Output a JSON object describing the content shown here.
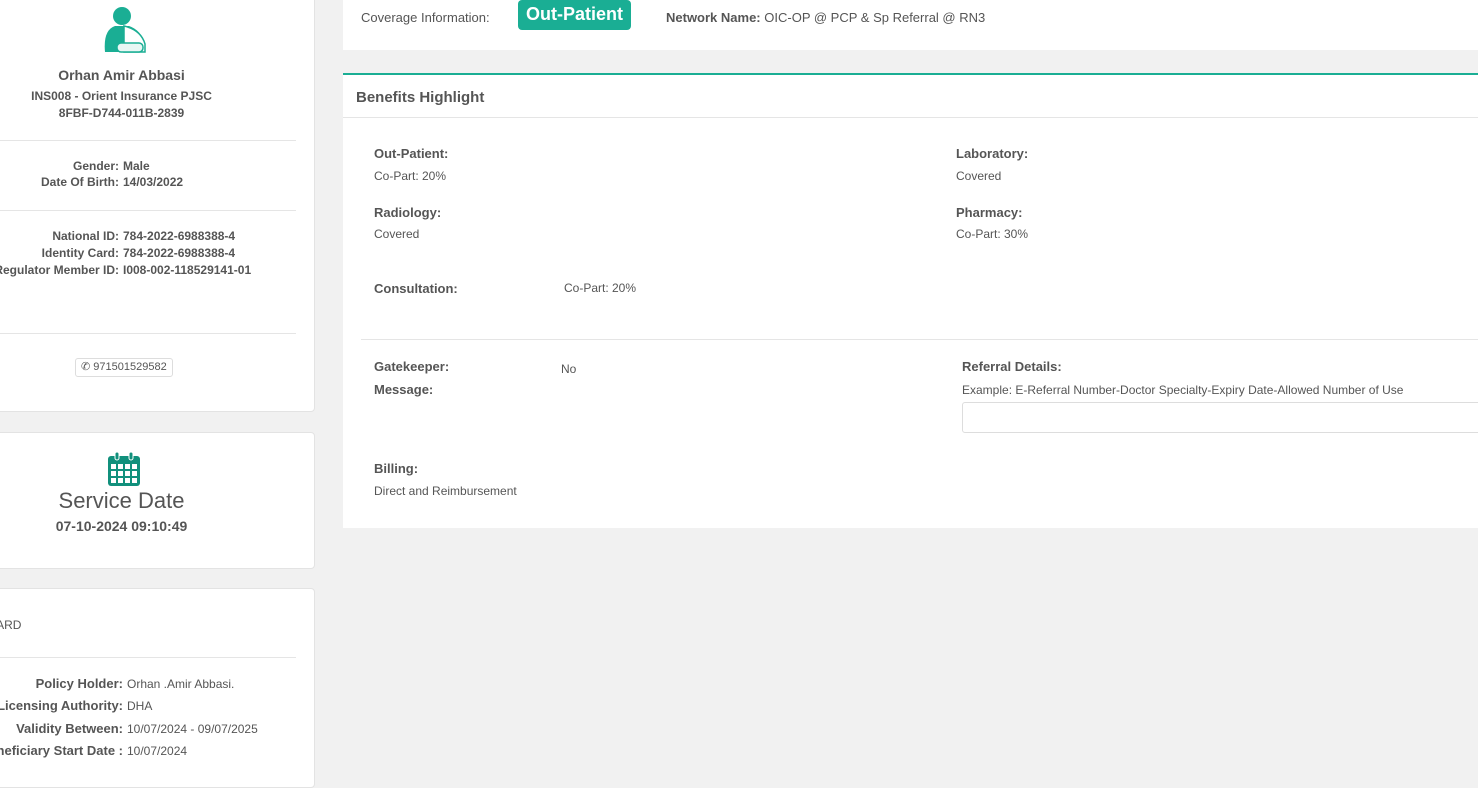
{
  "member": {
    "name": "Orhan Amir Abbasi",
    "insurer": "INS008 - Orient Insurance PJSC",
    "card_code": "8FBF-D744-011B-2839",
    "gender_label": "Gender:",
    "gender": "Male",
    "dob_label": "Date Of Birth:",
    "dob": "14/03/2022",
    "national_id_label": "National ID:",
    "national_id": "784-2022-6988388-4",
    "identity_card_label": "Identity Card:",
    "identity_card": "784-2022-6988388-4",
    "regulator_label": "Regulator Member ID:",
    "regulator_id": "I008-002-118529141-01",
    "phone": "971501529582"
  },
  "service": {
    "title": "Service Date",
    "datetime": "07-10-2024 09:10:49"
  },
  "policy": {
    "partial_text": "VARD",
    "policy_holder_label": "Policy Holder:",
    "policy_holder": "Orhan .Amir Abbasi.",
    "authority_label": "Licensing Authority:",
    "authority": "DHA",
    "validity_label": "Validity Between:",
    "validity": "10/07/2024 - 09/07/2025",
    "start_label": "eneficiary Start Date :",
    "start": "10/07/2024"
  },
  "coverage": {
    "label": "Coverage Information:",
    "badge": "Out-Patient",
    "network_label": "Network Name:",
    "network": "OIC-OP @ PCP & Sp Referral @ RN3"
  },
  "benefits": {
    "title": "Benefits Highlight",
    "outpatient_label": "Out-Patient:",
    "outpatient": "Co-Part: 20%",
    "laboratory_label": "Laboratory:",
    "laboratory": "Covered",
    "radiology_label": "Radiology:",
    "radiology": "Covered",
    "pharmacy_label": "Pharmacy:",
    "pharmacy": "Co-Part: 30%",
    "consultation_label": "Consultation:",
    "consultation": "Co-Part: 20%",
    "gatekeeper_label": "Gatekeeper:",
    "gatekeeper": "No",
    "message_label": "Message:",
    "referral_label": "Referral Details:",
    "referral_hint": "Example: E-Referral Number-Doctor Specialty-Expiry Date-Allowed Number of Use",
    "referral_value": "",
    "billing_label": "Billing:",
    "billing": "Direct and Reimbursement"
  },
  "colors": {
    "accent": "#1aae94",
    "calendar": "#11907c"
  }
}
